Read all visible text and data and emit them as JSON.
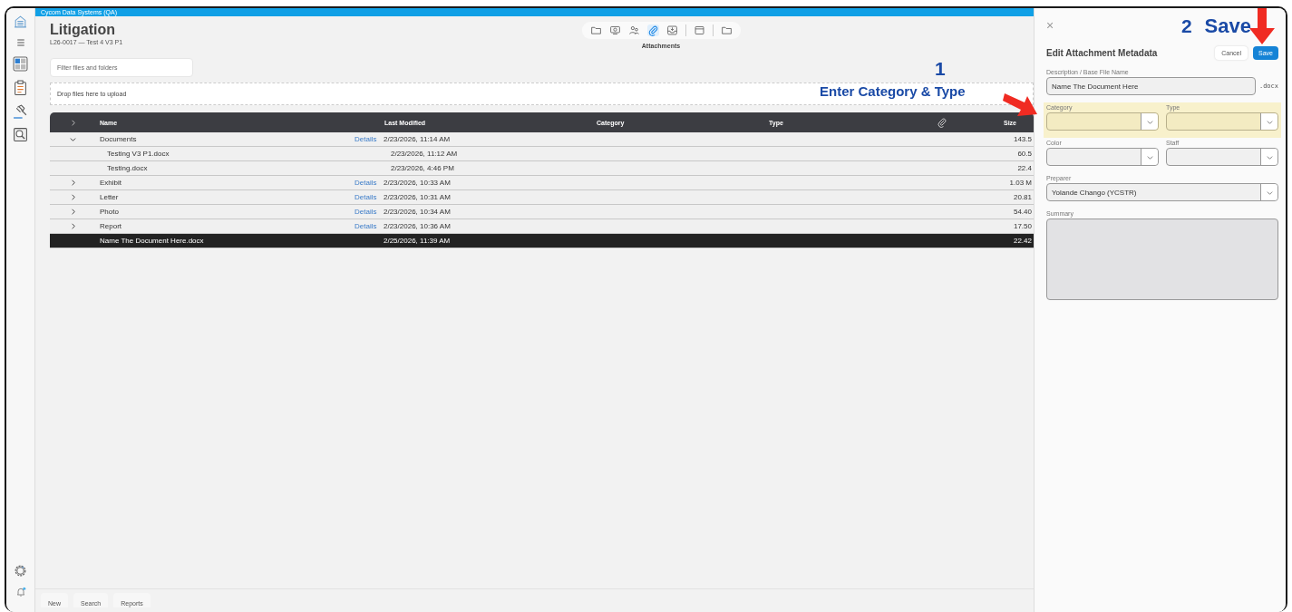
{
  "app_bar": {
    "title": "Cycom Data Systems (QA)"
  },
  "header": {
    "title": "Litigation",
    "subtitle": "L26-0017 — Test 4 V3 P1"
  },
  "toolbar": {
    "items": [
      {
        "selected": false
      },
      {
        "selected": false
      },
      {
        "selected": false
      },
      {
        "selected": true
      },
      {
        "selected": false
      },
      {
        "selected": false
      },
      {
        "selected": false
      }
    ],
    "caption": "Attachments"
  },
  "filter": {
    "placeholder": "Filter files and folders"
  },
  "dropzone": {
    "text": "Drop files here to upload"
  },
  "table": {
    "columns": [
      "Name",
      "Last Modified",
      "Category",
      "Type",
      "Size"
    ],
    "rows": [
      {
        "name": "Documents",
        "link": "Details",
        "modified": "2/23/2026, 11:14 AM",
        "size": "143.5",
        "expanded": true,
        "selected": false,
        "children": [
          {
            "name": "Testing V3 P1.docx",
            "modified": "2/23/2026, 11:12 AM",
            "size": "60.5",
            "selected": false
          },
          {
            "name": "Testing.docx",
            "modified": "2/23/2026, 4:46 PM",
            "size": "22.4",
            "selected": false
          }
        ]
      },
      {
        "name": "Exhibit",
        "link": "Details",
        "modified": "2/23/2026, 10:33 AM",
        "size": "1.03 M",
        "expanded": false,
        "selected": false
      },
      {
        "name": "Letter",
        "link": "Details",
        "modified": "2/23/2026, 10:31 AM",
        "size": "20.81",
        "expanded": false,
        "selected": false
      },
      {
        "name": "Photo",
        "link": "Details",
        "modified": "2/23/2026, 10:34 AM",
        "size": "54.40",
        "expanded": false,
        "selected": false
      },
      {
        "name": "Report",
        "link": "Details",
        "modified": "2/23/2026, 10:36 AM",
        "size": "17.50",
        "expanded": false,
        "selected": false
      },
      {
        "name": "Name The Document Here.docx",
        "modified": "2/25/2026, 11:39 AM",
        "size": "22.42",
        "selected": true
      }
    ]
  },
  "bottom_tabs": [
    "New",
    "Search",
    "Reports"
  ],
  "panel": {
    "close": "×",
    "title": "Edit Attachment Metadata",
    "cancel": "Cancel",
    "save": "Save",
    "rows": [
      {
        "highlighted": false,
        "fields": [
          {
            "kind": "text",
            "label": "Description / Base File Name",
            "value": "Name The Document Here",
            "suffix": ".docx"
          }
        ]
      },
      {
        "highlighted": true,
        "fields": [
          {
            "kind": "select",
            "label": "Category"
          },
          {
            "kind": "select",
            "label": "Type"
          }
        ]
      },
      {
        "highlighted": false,
        "fields": [
          {
            "kind": "select",
            "label": "Color"
          },
          {
            "kind": "select",
            "label": "Staff"
          }
        ]
      },
      {
        "highlighted": false,
        "fields": [
          {
            "kind": "select",
            "label": "Preparer",
            "value": "Yolande Chango (YCSTR)"
          }
        ]
      },
      {
        "highlighted": false,
        "fields": [
          {
            "kind": "textarea",
            "label": "Summary"
          }
        ]
      }
    ]
  },
  "annotations": [
    {
      "number": "1",
      "text": "Enter Category & Type"
    },
    {
      "number": "2",
      "text": "Save"
    }
  ]
}
